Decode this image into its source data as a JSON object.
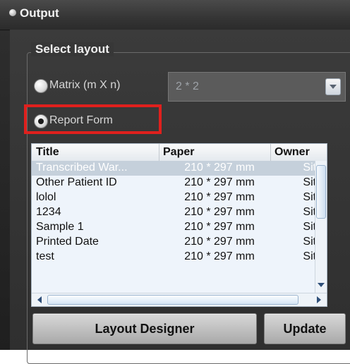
{
  "window": {
    "title": "Output"
  },
  "group": {
    "label": "Select layout"
  },
  "layout": {
    "matrix_label": "Matrix (m X n)",
    "matrix_value": "2 * 2",
    "report_label": "Report Form"
  },
  "table": {
    "headers": {
      "title": "Title",
      "paper": "Paper",
      "owner": "Owner"
    },
    "rows": [
      {
        "title": "Transcribed War...",
        "paper": "210 * 297 mm",
        "owner": "Site",
        "selected": true
      },
      {
        "title": "Other Patient ID",
        "paper": "210 * 297 mm",
        "owner": "Site"
      },
      {
        "title": "lolol",
        "paper": "210 * 297 mm",
        "owner": "Site"
      },
      {
        "title": "1234",
        "paper": "210 * 297 mm",
        "owner": "Site"
      },
      {
        "title": "Sample 1",
        "paper": "210 * 297 mm",
        "owner": "Site"
      },
      {
        "title": "Printed Date",
        "paper": "210 * 297 mm",
        "owner": "Site"
      },
      {
        "title": "test",
        "paper": "210 * 297 mm",
        "owner": "Site"
      }
    ]
  },
  "buttons": {
    "layout_designer": "Layout Designer",
    "update": "Update"
  },
  "icons": {
    "title_bullet": "bullet-icon",
    "dropdown": "chevron-down-icon",
    "scroll_up": "arrow-up-icon",
    "scroll_down": "arrow-down-icon",
    "scroll_left": "arrow-left-icon",
    "scroll_right": "arrow-right-icon"
  },
  "colors": {
    "highlight": "#e0201d",
    "selected_row": "#c5d0db",
    "table_bg": "#eef4fb",
    "window_bg": "#353535"
  }
}
